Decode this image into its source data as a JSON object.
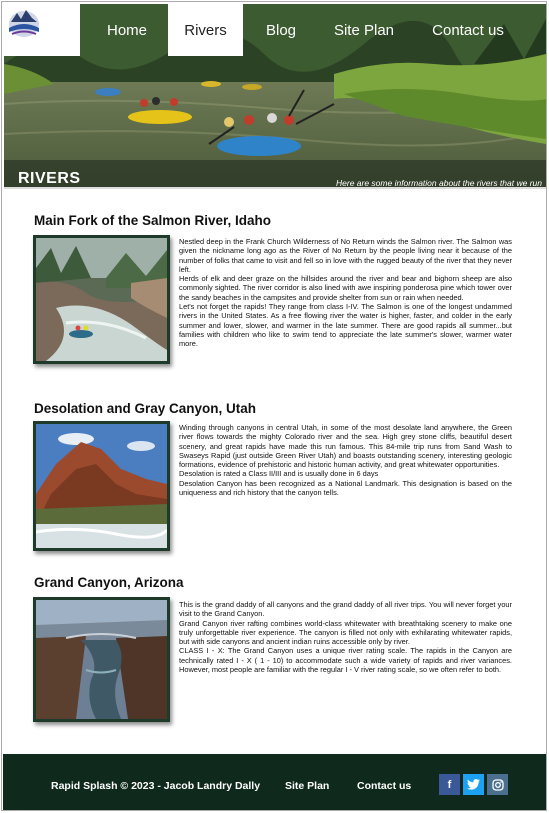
{
  "nav": {
    "items": [
      "Home",
      "Rivers",
      "Blog",
      "Site Plan",
      "Contact us"
    ],
    "active": "Rivers"
  },
  "hero": {
    "title": "RIVERS",
    "subtitle": "Here are some information about the rivers that we run"
  },
  "sections": [
    {
      "title": "Main Fork of the Salmon River, Idaho",
      "image_icon": "river-rafting-photo",
      "paragraphs": [
        "Nestled deep in the Frank Church Wilderness of No Return winds the Salmon river. The Salmon was given the nickname long ago as the River of No Return by the people living near it because of the number of folks that came to visit and fell so in love with the rugged beauty of the river that they never left.",
        "Herds of elk and deer graze on the hillsides around the river and bear and bighorn sheep are also commonly sighted. The river corridor is also lined with awe inspiring ponderosa pine which tower over the sandy beaches in the campsites and provide shelter from sun or rain when needed.",
        "Let's not forget the rapids! They range from class I-IV. The Salmon is one of the longest undammed rivers in the United States. As a free flowing river the water is higher, faster, and colder in the early summer and lower, slower, and warmer in the late summer. There are good rapids all summer...but families with children who like to swim tend to appreciate the late summer's slower, warmer water more."
      ]
    },
    {
      "title": "Desolation and Gray Canyon, Utah",
      "image_icon": "canyon-river-photo",
      "paragraphs": [
        "Winding through canyons in central Utah, in some of the most desolate land anywhere, the Green river flows towards the mighty Colorado river and the sea. High grey stone cliffs, beautiful desert scenery, and great rapids have made this run famous. This 84-mile trip runs from Sand Wash to Swaseys Rapid (just outside Green River Utah) and boasts outstanding scenery, interesting geologic formations, evidence of prehistoric and historic human activity, and great whitewater opportunities.",
        "Desolation is rated a Class II/III and is usually done in 6 days",
        "Desolation Canyon has been recognized as a National Landmark.  This designation is based on the uniqueness and rich history that the canyon tells."
      ]
    },
    {
      "title": "Grand Canyon, Arizona",
      "image_icon": "grand-canyon-photo",
      "paragraphs": [
        "This is the grand daddy of all canyons and the grand daddy of all river trips. You will never forget your visit to the Grand Canyon.",
        "Grand Canyon river rafting combines world-class whitewater with breathtaking scenery to make one truly unforgettable river experience. The canyon is filled not only with exhilarating whitewater rapids, but with side canyons and ancient indian ruins accessible only by river.",
        "CLASS I - X: The Grand Canyon uses a unique river rating scale. The rapids in the Canyon are technically rated I - X ( 1 - 10) to accommodate such a wide variety of rapids and river variances. However, most people are familiar with the regular I - V river rating scale, so we often refer to both."
      ]
    }
  ],
  "footer": {
    "copyright": "Rapid Splash © 2023 - Jacob Landry Dally",
    "links": [
      "Site Plan",
      "Contact us"
    ],
    "social": [
      {
        "icon": "facebook-icon",
        "glyph": "f",
        "color": "#3b5998"
      },
      {
        "icon": "twitter-icon",
        "glyph": "t",
        "color": "#1da1f2"
      },
      {
        "icon": "instagram-icon",
        "glyph": "◎",
        "color": "#4a6f8f"
      }
    ]
  },
  "colors": {
    "footer_bg": "#0f2a1c",
    "image_border": "#1d3a2a"
  }
}
